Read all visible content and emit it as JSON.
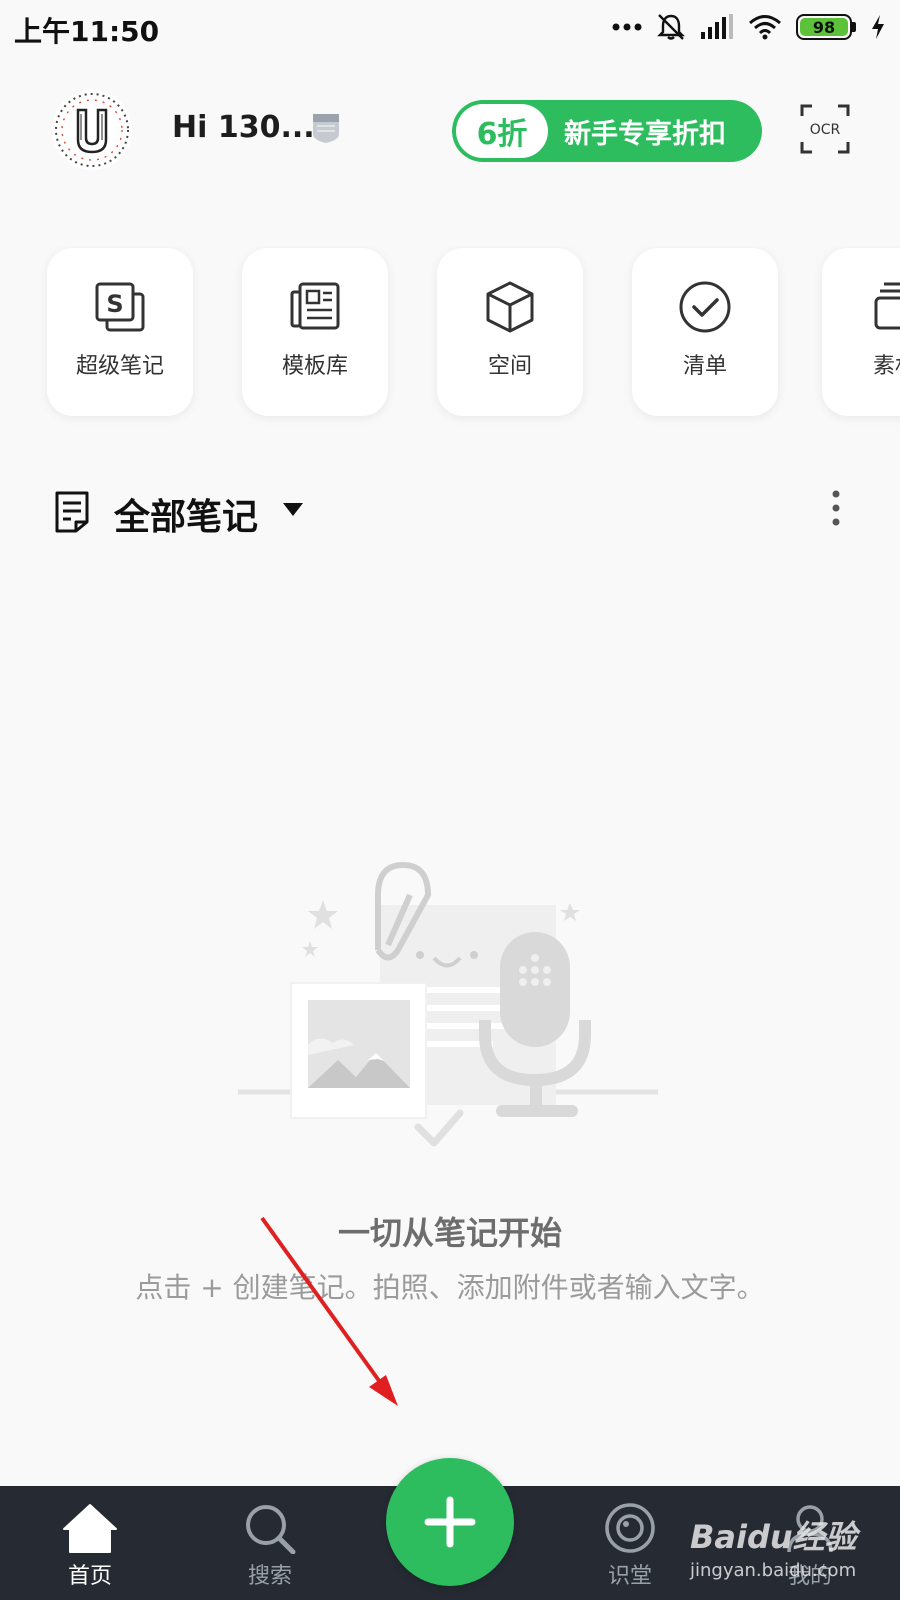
{
  "status_bar": {
    "time": "上午11:50",
    "battery": "98",
    "icons": [
      "dots-icon",
      "mute-icon",
      "signal-icon",
      "wifi-icon",
      "battery-icon",
      "charging-icon"
    ]
  },
  "header": {
    "greeting": "Hi 130...",
    "promo_discount": "6折",
    "promo_text": "新手专享折扣",
    "ocr_label": "OCR"
  },
  "quick_cards": [
    {
      "label": "超级笔记",
      "icon": "super-note-icon"
    },
    {
      "label": "模板库",
      "icon": "template-icon"
    },
    {
      "label": "空间",
      "icon": "cube-icon"
    },
    {
      "label": "清单",
      "icon": "checklist-icon"
    },
    {
      "label": "素材",
      "icon": "material-icon"
    }
  ],
  "notes": {
    "title": "全部笔记"
  },
  "empty_state": {
    "title": "一切从笔记开始",
    "subtitle": "点击 + 创建笔记。拍照、添加附件或者输入文字。"
  },
  "bottom_nav": [
    {
      "label": "首页",
      "icon": "home-icon",
      "active": true
    },
    {
      "label": "搜索",
      "icon": "search-icon",
      "active": false
    },
    {
      "label": "识堂",
      "icon": "school-icon",
      "active": false
    },
    {
      "label": "我的",
      "icon": "profile-icon",
      "active": false
    }
  ],
  "watermark": {
    "brand": "Baidu经验",
    "url": "jingyan.baidu.com"
  },
  "colors": {
    "accent": "#2dbd5f",
    "nav_bg": "#262b33",
    "arrow": "#e02020"
  }
}
